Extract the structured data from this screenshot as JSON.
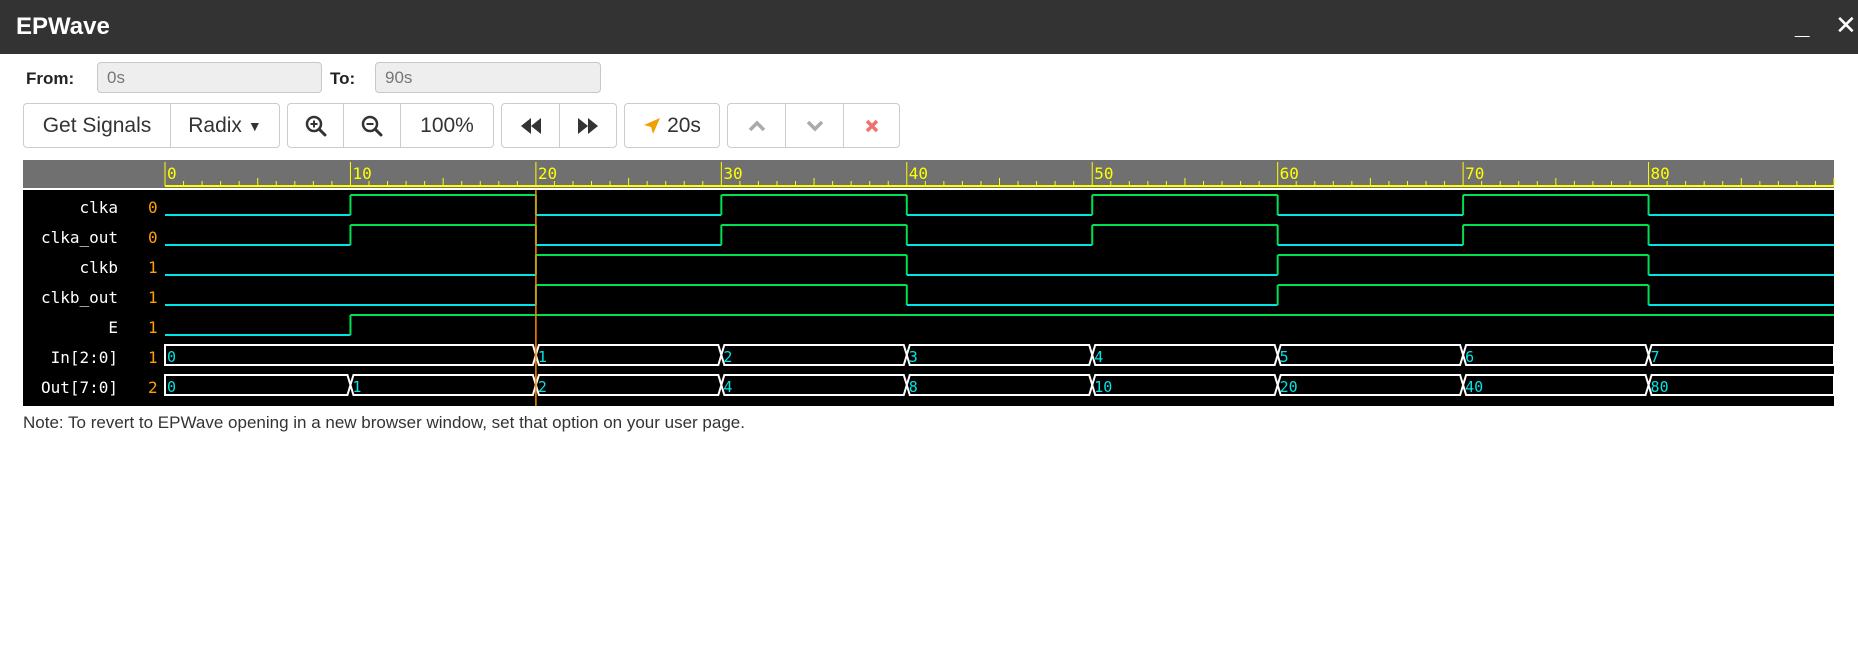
{
  "window": {
    "title": "EPWave"
  },
  "range": {
    "from_label": "From:",
    "from_value": "0s",
    "to_label": "To:",
    "to_value": "90s"
  },
  "toolbar": {
    "get_signals": "Get Signals",
    "radix": "Radix",
    "zoom": "100%",
    "cursor_time": "20s"
  },
  "timeline": {
    "time_max": 90,
    "major_ticks": [
      0,
      10,
      20,
      30,
      40,
      50,
      60,
      70,
      80
    ],
    "cursor_time": 20,
    "colors": {
      "ruler_bg": "#707070",
      "ruler_fg": "#ffff00",
      "low": "#00e5e5",
      "high": "#00e050",
      "label_text": "#ffffff",
      "value_text": "#ffa000",
      "bus": "#ffffff",
      "bus_text": "#00e5e5",
      "cursor": "#ff8800"
    }
  },
  "signals": [
    {
      "name": "clka",
      "value": "0",
      "type": "bit",
      "changes": [
        [
          0,
          0
        ],
        [
          10,
          1
        ],
        [
          20,
          0
        ],
        [
          30,
          1
        ],
        [
          40,
          0
        ],
        [
          50,
          1
        ],
        [
          60,
          0
        ],
        [
          70,
          1
        ],
        [
          80,
          0
        ]
      ]
    },
    {
      "name": "clka_out",
      "value": "0",
      "type": "bit",
      "changes": [
        [
          0,
          0
        ],
        [
          10,
          1
        ],
        [
          20,
          0
        ],
        [
          30,
          1
        ],
        [
          40,
          0
        ],
        [
          50,
          1
        ],
        [
          60,
          0
        ],
        [
          70,
          1
        ],
        [
          80,
          0
        ]
      ]
    },
    {
      "name": "clkb",
      "value": "1",
      "type": "bit",
      "changes": [
        [
          0,
          0
        ],
        [
          20,
          1
        ],
        [
          40,
          0
        ],
        [
          60,
          1
        ],
        [
          80,
          0
        ]
      ]
    },
    {
      "name": "clkb_out",
      "value": "1",
      "type": "bit",
      "changes": [
        [
          0,
          0
        ],
        [
          20,
          1
        ],
        [
          40,
          0
        ],
        [
          60,
          1
        ],
        [
          80,
          0
        ]
      ]
    },
    {
      "name": "E",
      "value": "1",
      "type": "bit",
      "changes": [
        [
          0,
          0
        ],
        [
          10,
          1
        ]
      ]
    },
    {
      "name": "In[2:0]",
      "value": "1",
      "type": "bus",
      "changes": [
        [
          0,
          "0"
        ],
        [
          20,
          "1"
        ],
        [
          30,
          "2"
        ],
        [
          40,
          "3"
        ],
        [
          50,
          "4"
        ],
        [
          60,
          "5"
        ],
        [
          70,
          "6"
        ],
        [
          80,
          "7"
        ]
      ]
    },
    {
      "name": "Out[7:0]",
      "value": "2",
      "type": "bus",
      "changes": [
        [
          0,
          "0"
        ],
        [
          10,
          "1"
        ],
        [
          20,
          "2"
        ],
        [
          30,
          "4"
        ],
        [
          40,
          "8"
        ],
        [
          50,
          "10"
        ],
        [
          60,
          "20"
        ],
        [
          70,
          "40"
        ],
        [
          80,
          "80"
        ]
      ]
    }
  ],
  "note": "Note: To revert to EPWave opening in a new browser window, set that option on your user page."
}
